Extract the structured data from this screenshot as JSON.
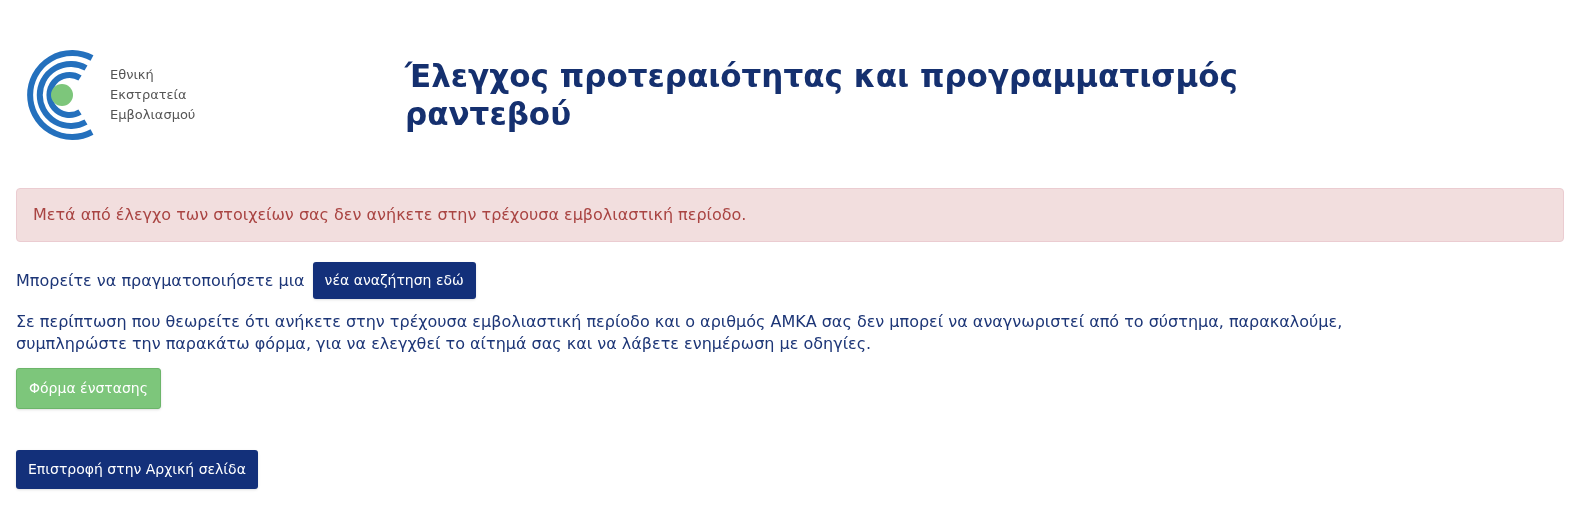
{
  "logo": {
    "lines": [
      "Εθνική",
      "Εκστρατεία",
      "Εμβολιασμού"
    ]
  },
  "title": "Έλεγχος προτεραιότητας και προγραμματισμός ραντεβού",
  "alert": {
    "kind": "danger",
    "text": "Μετά από έλεγχο των στοιχείων σας δεν ανήκετε στην τρέχουσα εμβολιαστική περίοδο."
  },
  "new_search": {
    "text": "Μπορείτε να πραγματοποιήσετε μια",
    "button": "νέα αναζήτηση εδώ"
  },
  "objection": {
    "text": "Σε περίπτωση που θεωρείτε ότι ανήκετε στην τρέχουσα εμβολιαστική περίοδο και ο αριθμός ΑΜΚΑ σας δεν μπορεί να αναγνωριστεί από το σύστημα, παρακαλούμε, συμπληρώστε την παρακάτω φόρμα, για να ελεγχθεί το αίτημά σας και να λάβετε ενημέρωση με οδηγίες.",
    "button": "Φόρμα ένστασης"
  },
  "home_button": "Επιστροφή στην Αρχική σελίδα"
}
